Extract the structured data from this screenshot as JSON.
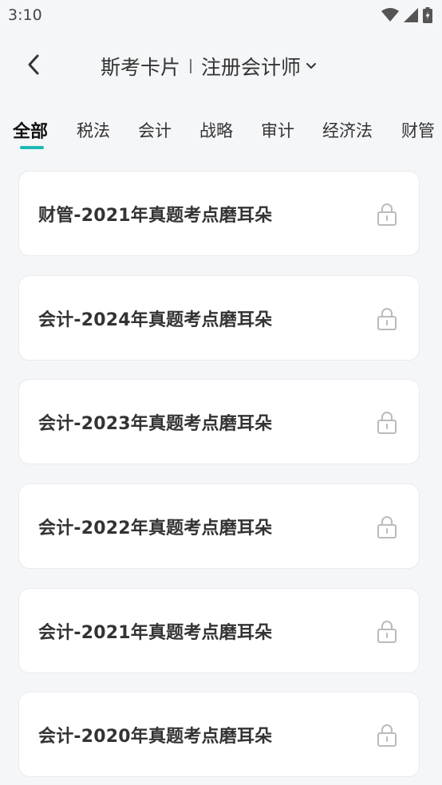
{
  "status_bar": {
    "time": "3:10"
  },
  "header": {
    "back_icon": "chevron-left-icon",
    "title": "斯考卡片",
    "subject": "注册会计师",
    "caret_icon": "chevron-down-icon"
  },
  "tabs": [
    {
      "label": "全部",
      "active": true
    },
    {
      "label": "税法",
      "active": false
    },
    {
      "label": "会计",
      "active": false
    },
    {
      "label": "战略",
      "active": false
    },
    {
      "label": "审计",
      "active": false
    },
    {
      "label": "经济法",
      "active": false
    },
    {
      "label": "财管",
      "active": false
    }
  ],
  "accent_color": "#1fb8b3",
  "cards": [
    {
      "title": "财管-2021年真题考点磨耳朵",
      "locked": true
    },
    {
      "title": "会计-2024年真题考点磨耳朵",
      "locked": true
    },
    {
      "title": "会计-2023年真题考点磨耳朵",
      "locked": true
    },
    {
      "title": "会计-2022年真题考点磨耳朵",
      "locked": true
    },
    {
      "title": "会计-2021年真题考点磨耳朵",
      "locked": true
    },
    {
      "title": "会计-2020年真题考点磨耳朵",
      "locked": true
    }
  ]
}
